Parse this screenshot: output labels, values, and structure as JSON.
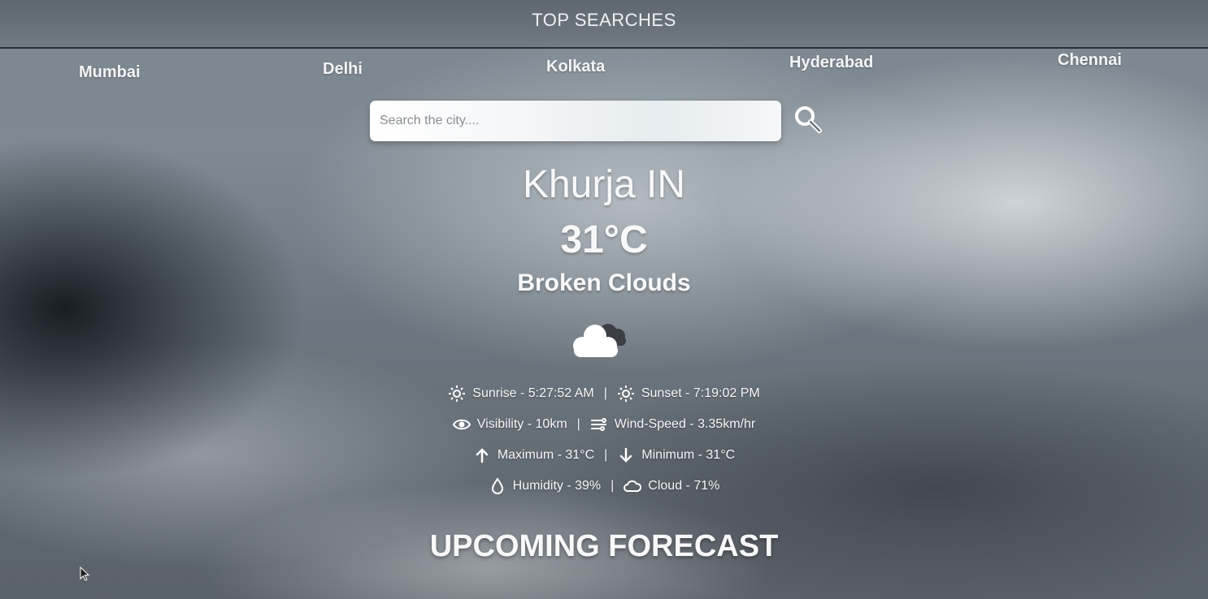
{
  "header": {
    "title": "TOP SEARCHES"
  },
  "top_searches": [
    "Mumbai",
    "Delhi",
    "Kolkata",
    "Hyderabad",
    "Chennai"
  ],
  "search": {
    "placeholder": "Search the city....",
    "icon": "search-icon"
  },
  "weather": {
    "location": "Khurja IN",
    "temperature": "31°C",
    "description": "Broken Clouds",
    "icon": "cloud-icon"
  },
  "details": {
    "sunrise": "Sunrise - 5:27:52 AM",
    "sunset": "Sunset - 7:19:02 PM",
    "visibility": "Visibility - 10km",
    "wind_speed": "Wind-Speed - 3.35km/hr",
    "maximum": "Maximum - 31°C",
    "minimum": "Minimum - 31°C",
    "humidity": "Humidity - 39%",
    "cloud": "Cloud - 71%",
    "separator": "|"
  },
  "forecast": {
    "title": "UPCOMING FORECAST"
  }
}
